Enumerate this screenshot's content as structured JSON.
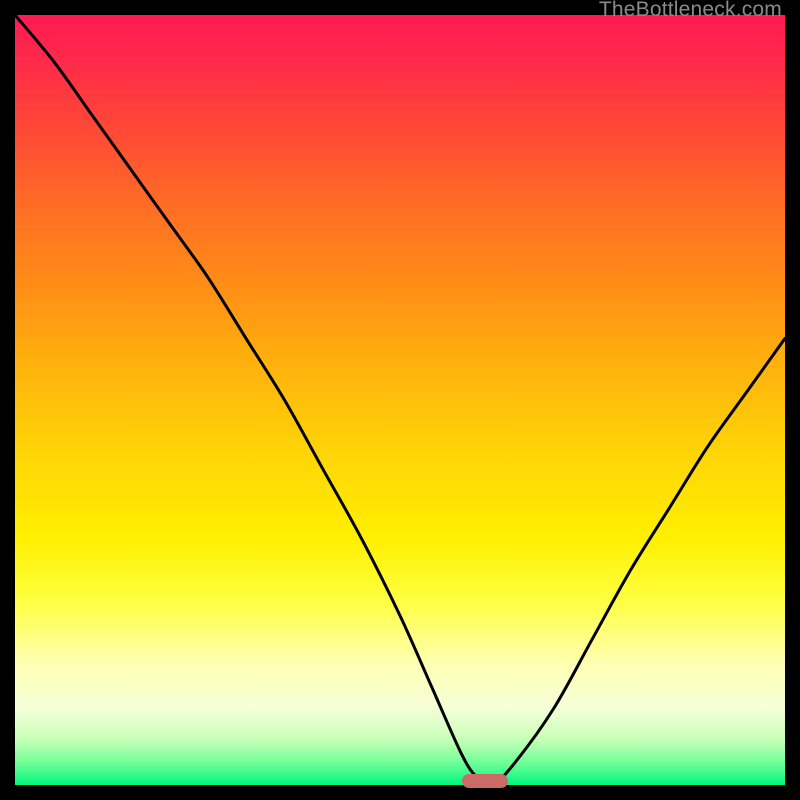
{
  "watermark": "TheBottleneck.com",
  "colors": {
    "frame": "#000000",
    "marker": "#cc6b66",
    "curve": "#000000"
  },
  "chart_data": {
    "type": "line",
    "title": "",
    "xlabel": "",
    "ylabel": "",
    "xlim": [
      0,
      100
    ],
    "ylim": [
      0,
      100
    ],
    "grid": false,
    "series": [
      {
        "name": "bottleneck-curve",
        "x": [
          0,
          5,
          10,
          15,
          20,
          25,
          30,
          35,
          40,
          45,
          50,
          54,
          58,
          60,
          62,
          65,
          70,
          75,
          80,
          85,
          90,
          95,
          100
        ],
        "y": [
          100,
          94,
          87,
          80,
          73,
          66,
          58,
          50,
          41,
          32,
          22,
          13,
          4,
          1,
          0,
          3,
          10,
          19,
          28,
          36,
          44,
          51,
          58
        ]
      }
    ],
    "annotations": [
      {
        "name": "optimal-marker",
        "x": 61,
        "y": 0.5
      }
    ]
  }
}
